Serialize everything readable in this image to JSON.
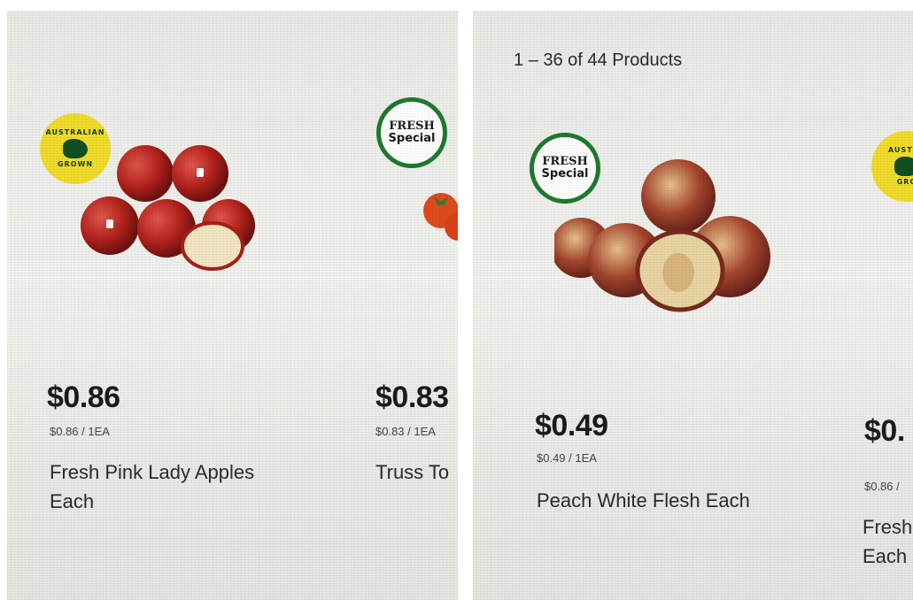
{
  "left_photo": {
    "cards": [
      {
        "badge": {
          "type": "australian-grown",
          "text_top": "AUSTRALIAN",
          "text_bottom": "GROWN"
        },
        "image_icon": "pink-lady-apples",
        "price": "$0.86",
        "unit_price": "$0.86 / 1EA",
        "name_line1": "Fresh Pink Lady Apples",
        "name_line2": "Each"
      },
      {
        "badge": {
          "type": "fresh-special",
          "line1": "FRESH",
          "line2": "Special"
        },
        "image_icon": "truss-tomatoes",
        "price": "$0.83",
        "unit_price": "$0.83 / 1EA",
        "name_line1": "Truss To"
      }
    ]
  },
  "right_photo": {
    "results_count": "1 – 36 of 44 Products",
    "cards": [
      {
        "badge": {
          "type": "fresh-special",
          "line1": "FRESH",
          "line2": "Special"
        },
        "image_icon": "white-flesh-peaches",
        "price": "$0.49",
        "unit_price": "$0.49 / 1EA",
        "name_line1": "Peach White Flesh Each"
      },
      {
        "badge": {
          "type": "australian-grown",
          "text_top": "AUSTRA",
          "text_bottom": "GRO"
        },
        "price": "$0.",
        "unit_price": "$0.86 /",
        "name_line1": "Fresh",
        "name_line2": "Each"
      }
    ]
  },
  "colors": {
    "fresh_badge_ring": "#1f7a2e",
    "aus_badge_fill": "#f0dc2a",
    "apple_red": "#b3221c",
    "peach_flesh": "#e7d6a2",
    "peach_skin": "#8a2e20"
  }
}
